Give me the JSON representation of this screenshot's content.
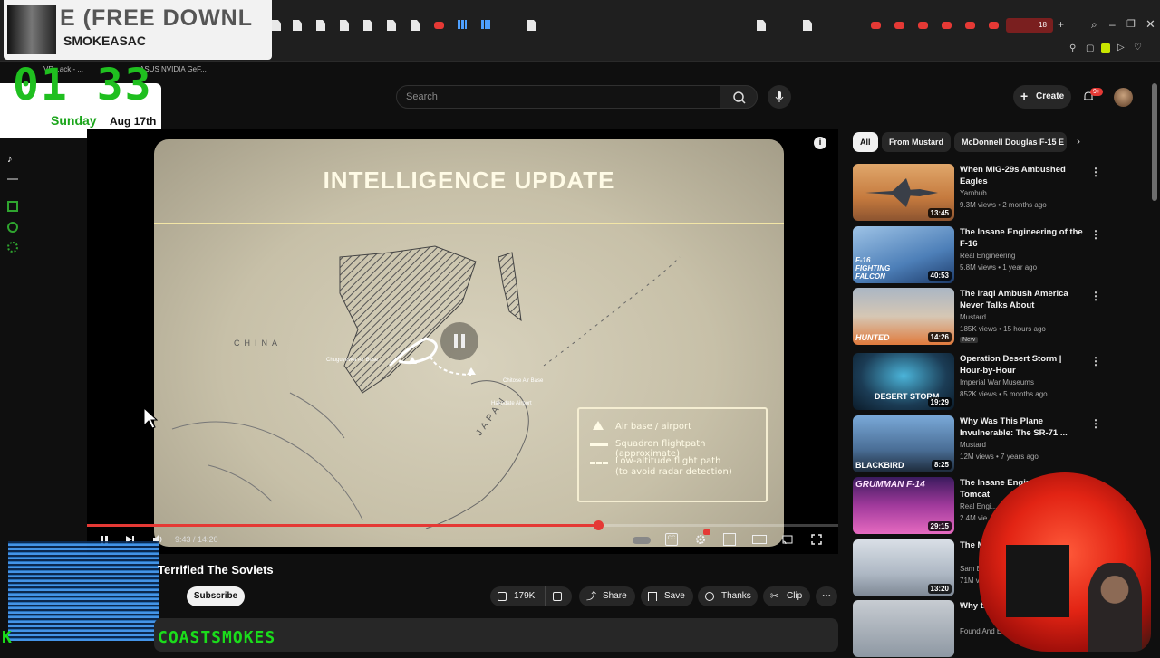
{
  "browser": {
    "bookmarks": [
      "VR...ack - ...",
      "ASUS NVIDIA GeF..."
    ],
    "tab_counter": "18"
  },
  "overlay": {
    "banner_big": "E (FREE DOWNL",
    "banner_small": "SMOKEASAC",
    "clock_time": "01 33",
    "clock_day": "Sunday",
    "clock_date": "Aug 17th",
    "kick_prefix": "K",
    "streamer_name": "COASTSMOKES"
  },
  "header": {
    "search_placeholder": "Search",
    "create_label": "Create",
    "notif_count": "9+"
  },
  "player": {
    "slide_title": "INTELLIGENCE UPDATE",
    "map_label_china": "CHINA",
    "map_label_japan": "JAPAN",
    "map_label_airbase1": "Chuguyevka Air Base",
    "map_label_airbase2": "Chitose Air Base",
    "map_label_airport": "Hakodate Airport",
    "legend": {
      "item1": "Air base / airport",
      "item2": "Squadron flightpath (approximate)",
      "item3_line1": "Low-altitude flight path",
      "item3_line2": "(to avoid radar detection)"
    },
    "time": "9:43 / 14:20",
    "progress": 0.68
  },
  "video": {
    "title_fragment": "Terrified The Soviets",
    "subscribe_label": "Subscribe",
    "actions": {
      "likes": "179K",
      "share": "Share",
      "save": "Save",
      "thanks": "Thanks",
      "clip": "Clip"
    }
  },
  "chips": [
    "All",
    "From Mustard",
    "McDonnell Douglas F-15 E"
  ],
  "recommendations": [
    {
      "title": "When MiG-29s Ambushed Eagles",
      "channel": "Yarnhub",
      "meta": "9.3M views • 2 months ago",
      "duration": "13:45",
      "thumb_text": "",
      "badge": ""
    },
    {
      "title": "The Insane Engineering of the F-16",
      "channel": "Real Engineering",
      "meta": "5.8M views • 1 year ago",
      "duration": "40:53",
      "thumb_text": "F-16 FIGHTING FALCON",
      "badge": ""
    },
    {
      "title": "The Iraqi Ambush America Never Talks About",
      "channel": "Mustard",
      "meta": "185K views • 15 hours ago",
      "duration": "14:26",
      "thumb_text": "HUNTED",
      "badge": "New"
    },
    {
      "title": "Operation Desert Storm | Hour-by-Hour",
      "channel": "Imperial War Museums",
      "meta": "852K views • 5 months ago",
      "duration": "19:29",
      "thumb_text": "DESERT STORM",
      "badge": ""
    },
    {
      "title": "Why Was This Plane Invulnerable: The SR-71 ...",
      "channel": "Mustard",
      "meta": "12M views • 7 years ago",
      "duration": "8:25",
      "thumb_text": "BLACKBIRD",
      "badge": ""
    },
    {
      "title": "The Insane Engine... F-14 Tomcat",
      "channel": "Real Engi...",
      "meta": "2.4M vie...",
      "duration": "29:15",
      "thumb_text": "GRUMMAN F-14",
      "badge": ""
    },
    {
      "title": "The M... Ever...",
      "channel": "Sam E...",
      "meta": "71M vie...",
      "duration": "13:20",
      "thumb_text": "",
      "badge": ""
    },
    {
      "title": "Why the ... 16 failed -",
      "channel": "Found And Exp...",
      "meta": "",
      "duration": "",
      "thumb_text": "",
      "badge": ""
    }
  ],
  "colors": {
    "accent": "#e53935",
    "overlay_green": "#1bdc1b",
    "slide_bg": "#c7c0a8"
  }
}
